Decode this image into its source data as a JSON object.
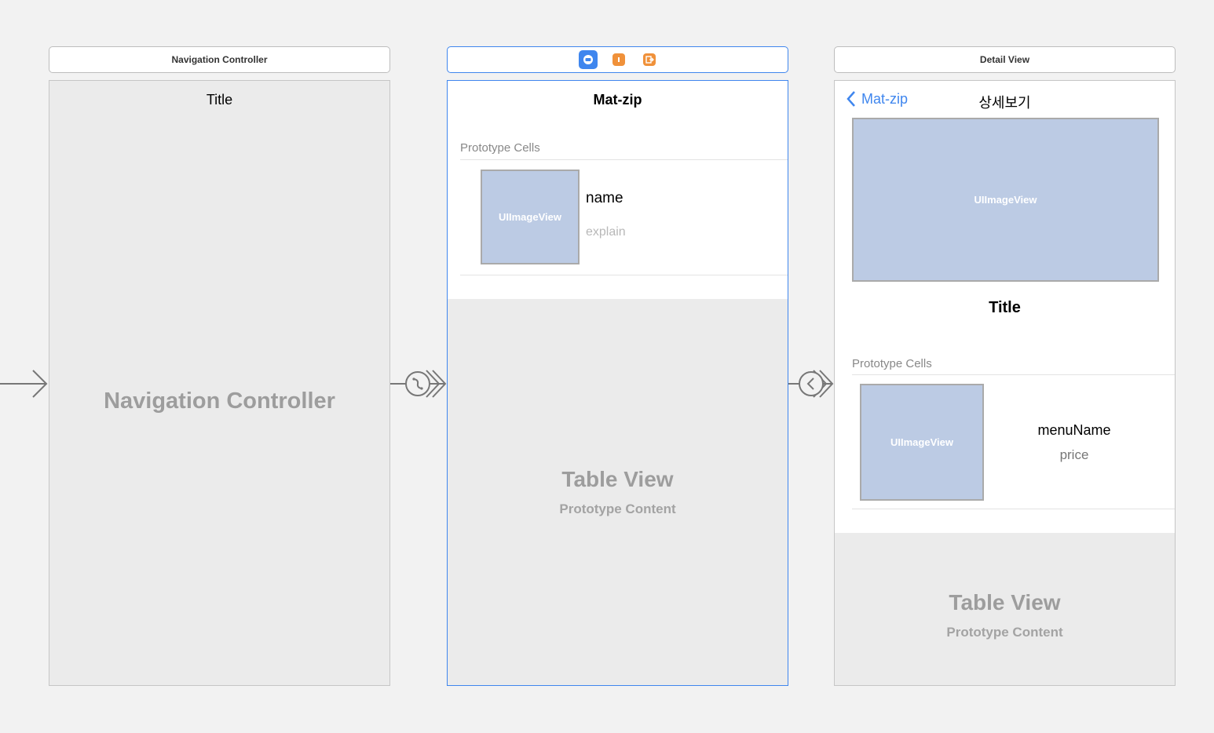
{
  "nav_scene": {
    "header": "Navigation Controller",
    "nav_title": "Title",
    "placeholder": "Navigation Controller"
  },
  "list_scene": {
    "header_icons": [
      "view-controller-icon",
      "first-responder-icon",
      "exit-icon"
    ],
    "nav_title": "Mat-zip",
    "section_header": "Prototype Cells",
    "cell": {
      "image_label": "UIImageView",
      "name": "name",
      "explain": "explain"
    },
    "table_placeholder": "Table View",
    "table_sub": "Prototype Content"
  },
  "detail_scene": {
    "header": "Detail View",
    "back_label": "Mat-zip",
    "nav_title": "상세보기",
    "hero_image_label": "UIImageView",
    "title": "Title",
    "section_header": "Prototype Cells",
    "cell": {
      "image_label": "UIImageView",
      "menu_name": "menuName",
      "price": "price"
    },
    "table_placeholder": "Table View",
    "table_sub": "Prototype Content"
  },
  "colors": {
    "accent": "#3f86ee",
    "image_placeholder": "#bccbe4",
    "responder_orange": "#f0913a"
  }
}
